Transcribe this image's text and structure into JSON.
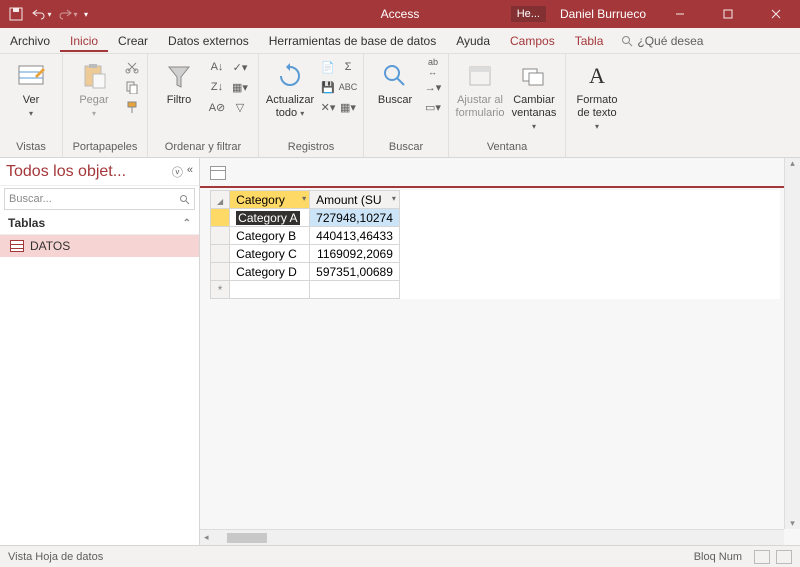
{
  "titlebar": {
    "app_name": "Access",
    "badge": "He...",
    "user": "Daniel Burrueco"
  },
  "menu": {
    "file": "Archivo",
    "home": "Inicio",
    "create": "Crear",
    "external": "Datos externos",
    "dbtools": "Herramientas de base de datos",
    "help": "Ayuda",
    "fields": "Campos",
    "table": "Tabla",
    "tellme_placeholder": "¿Qué desea"
  },
  "ribbon": {
    "views": {
      "label": "Ver",
      "group": "Vistas"
    },
    "clipboard": {
      "paste": "Pegar",
      "group": "Portapapeles"
    },
    "sort": {
      "filter": "Filtro",
      "group": "Ordenar y filtrar"
    },
    "records": {
      "refresh": "Actualizar todo",
      "group": "Registros"
    },
    "find": {
      "find": "Buscar",
      "group": "Buscar"
    },
    "window": {
      "fit": "Ajustar al formulario",
      "switch": "Cambiar ventanas",
      "group": "Ventana"
    },
    "textfmt": {
      "format": "Formato de texto"
    }
  },
  "nav": {
    "title": "Todos los objet...",
    "search_placeholder": "Buscar...",
    "section": "Tablas",
    "item": "DATOS"
  },
  "table": {
    "columns": [
      "Category",
      "Amount (SU"
    ],
    "rows": [
      {
        "category": "Category A",
        "amount": "727948,10274"
      },
      {
        "category": "Category B",
        "amount": "440413,46433"
      },
      {
        "category": "Category C",
        "amount": "1169092,2069"
      },
      {
        "category": "Category D",
        "amount": "597351,00689"
      }
    ],
    "newrow_marker": "*"
  },
  "statusbar": {
    "view": "Vista Hoja de datos",
    "lock": "Bloq Num"
  }
}
